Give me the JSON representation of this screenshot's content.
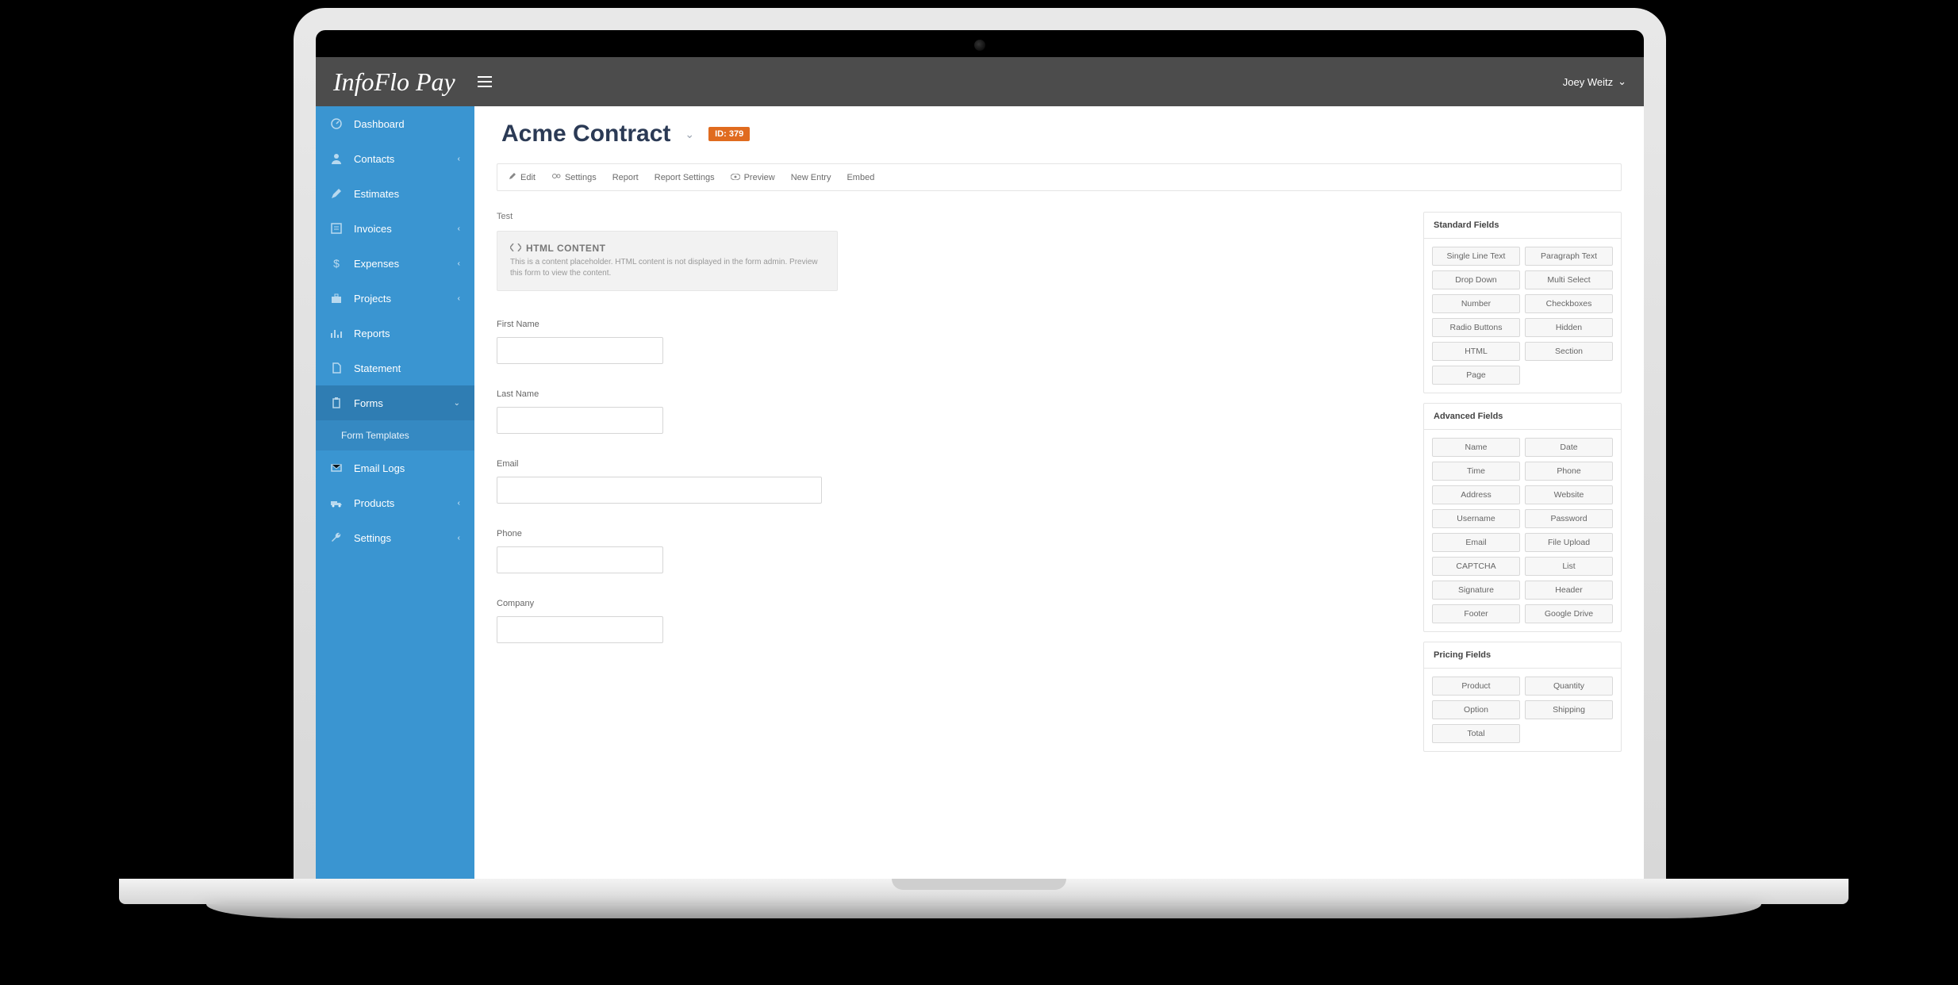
{
  "brand": "InfoFlo Pay",
  "user": {
    "name": "Joey Weitz"
  },
  "sidebar": {
    "items": [
      {
        "label": "Dashboard",
        "icon": "dashboard",
        "expandable": false
      },
      {
        "label": "Contacts",
        "icon": "user",
        "expandable": true
      },
      {
        "label": "Estimates",
        "icon": "pencil",
        "expandable": false
      },
      {
        "label": "Invoices",
        "icon": "invoice",
        "expandable": true
      },
      {
        "label": "Expenses",
        "icon": "dollar",
        "expandable": true
      },
      {
        "label": "Projects",
        "icon": "briefcase",
        "expandable": true
      },
      {
        "label": "Reports",
        "icon": "chart",
        "expandable": false
      },
      {
        "label": "Statement",
        "icon": "file",
        "expandable": false
      },
      {
        "label": "Forms",
        "icon": "clipboard",
        "expandable": true,
        "active": true,
        "sub": [
          {
            "label": "Form Templates"
          }
        ]
      },
      {
        "label": "Email Logs",
        "icon": "envelope",
        "expandable": false
      },
      {
        "label": "Products",
        "icon": "truck",
        "expandable": true
      },
      {
        "label": "Settings",
        "icon": "wrench",
        "expandable": true
      }
    ]
  },
  "page": {
    "title": "Acme Contract",
    "id_label": "ID: 379"
  },
  "actions": [
    {
      "label": "Edit",
      "icon": "edit"
    },
    {
      "label": "Settings",
      "icon": "gears"
    },
    {
      "label": "Report",
      "icon": ""
    },
    {
      "label": "Report Settings",
      "icon": ""
    },
    {
      "label": "Preview",
      "icon": "eye"
    },
    {
      "label": "New Entry",
      "icon": ""
    },
    {
      "label": "Embed",
      "icon": ""
    }
  ],
  "form": {
    "test_label": "Test",
    "html_title": "HTML CONTENT",
    "html_desc": "This is a content placeholder. HTML content is not displayed in the form admin. Preview this form to view the content.",
    "fields": [
      {
        "label": "First Name",
        "size": "short"
      },
      {
        "label": "Last Name",
        "size": "short"
      },
      {
        "label": "Email",
        "size": "long"
      },
      {
        "label": "Phone",
        "size": "short"
      },
      {
        "label": "Company",
        "size": "short"
      }
    ]
  },
  "rail": {
    "panels": [
      {
        "title": "Standard Fields",
        "buttons": [
          "Single Line Text",
          "Paragraph Text",
          "Drop Down",
          "Multi Select",
          "Number",
          "Checkboxes",
          "Radio Buttons",
          "Hidden",
          "HTML",
          "Section",
          "Page"
        ]
      },
      {
        "title": "Advanced Fields",
        "buttons": [
          "Name",
          "Date",
          "Time",
          "Phone",
          "Address",
          "Website",
          "Username",
          "Password",
          "Email",
          "File Upload",
          "CAPTCHA",
          "List",
          "Signature",
          "Header",
          "Footer",
          "Google Drive"
        ]
      },
      {
        "title": "Pricing Fields",
        "buttons": [
          "Product",
          "Quantity",
          "Option",
          "Shipping",
          "Total"
        ]
      }
    ]
  }
}
